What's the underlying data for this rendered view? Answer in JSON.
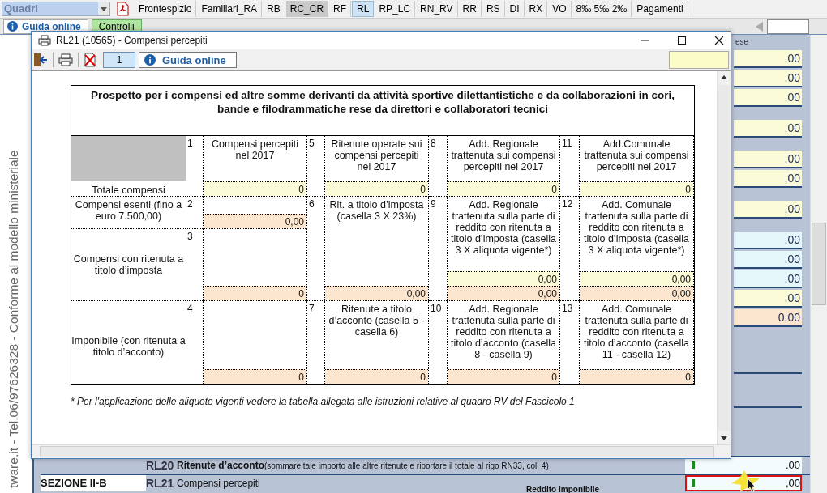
{
  "app": {
    "section_dropdown": {
      "value": "Quadri"
    },
    "tabs": [
      {
        "label": "Frontespizio",
        "selected": false,
        "pressed": false
      },
      {
        "label": "Familiari_RA",
        "selected": false,
        "pressed": false
      },
      {
        "label": "RB",
        "selected": false,
        "pressed": false
      },
      {
        "label": "RC_CR",
        "selected": false,
        "pressed": true
      },
      {
        "label": "RF",
        "selected": false,
        "pressed": false
      },
      {
        "label": "RL",
        "selected": true,
        "pressed": false
      },
      {
        "label": "RP_LC",
        "selected": false,
        "pressed": false
      },
      {
        "label": "RN_RV",
        "selected": false,
        "pressed": false
      },
      {
        "label": "RR",
        "selected": false,
        "pressed": false
      },
      {
        "label": "RS",
        "selected": false,
        "pressed": false
      },
      {
        "label": "DI",
        "selected": false,
        "pressed": false
      },
      {
        "label": "RX",
        "selected": false,
        "pressed": false
      },
      {
        "label": "VO",
        "selected": false,
        "pressed": false
      },
      {
        "label": "8‰ 5‰ 2‰",
        "selected": false,
        "pressed": false
      },
      {
        "label": "Pagamenti",
        "selected": false,
        "pressed": false
      }
    ],
    "toolbar": {
      "help_button": "Guida online",
      "checks_button": "Controlli"
    },
    "side_text": "tware.it - Tel.06/97626328 - Conforme al modello ministeriale",
    "column_header": "ese",
    "field_groups": [
      [
        {
          "value": ",00",
          "kind": "input"
        },
        {
          "value": ",00",
          "kind": "input"
        },
        {
          "value": ",00",
          "kind": "input"
        }
      ],
      [
        {
          "value": ",00",
          "kind": "input"
        }
      ],
      [
        {
          "value": ",00",
          "kind": "input"
        },
        {
          "value": ",00",
          "kind": "input"
        }
      ],
      [
        {
          "value": ",00",
          "kind": "input"
        }
      ],
      [
        {
          "value": ",00",
          "kind": "linked"
        },
        {
          "value": ",00",
          "kind": "linked"
        },
        {
          "value": ",00",
          "kind": "linked"
        },
        {
          "value": ",00",
          "kind": "input"
        },
        {
          "value": "0,00",
          "kind": "calculated"
        }
      ]
    ],
    "rows": [
      {
        "code": "RL20",
        "label": "Ritenute d’acconto",
        "note": "(sommare tale importo alle altre ritenute e riportare il totale al rigo RN33, col. 4)",
        "value": ".00",
        "highlighted": false
      },
      {
        "section": "SEZIONE II-B",
        "code": "RL21",
        "label": "Compensi percepiti",
        "value": ",00",
        "highlighted": true
      }
    ],
    "next_header": "Reddito imponibile"
  },
  "dialog": {
    "title": "RL21 (10565) - Compensi percepiti",
    "page": "1",
    "help_button": "Guida online",
    "table": {
      "title": "Prospetto per i compensi ed altre somme derivanti da attività sportive dilettantistiche e da collaborazioni in cori, bande e filodrammatiche rese da direttori e collaboratori tecnici",
      "row_labels": [
        "Totale compensi",
        "Compensi esenti (fino a euro 7.500,00)",
        "Compensi con ritenuta a titolo d’imposta",
        "Imponibile (con ritenuta a titolo d’acconto)"
      ],
      "columns": [
        {
          "boxes": [
            {
              "number": "1",
              "label": "Compensi percepiti nel 2017",
              "values": [
                {
                  "text": "0",
                  "kind": "input"
                }
              ]
            },
            {
              "number": "2",
              "values": [
                {
                  "text": "0,00",
                  "kind": "calculated"
                }
              ]
            },
            {
              "number": "3",
              "values": [
                {
                  "text": "0",
                  "kind": "calculated"
                }
              ]
            },
            {
              "number": "4",
              "values": [
                {
                  "text": "0",
                  "kind": "calculated"
                }
              ]
            }
          ]
        },
        {
          "boxes": [
            {
              "number": "5",
              "label": "Ritenute operate sui compensi percepiti nel 2017",
              "values": [
                {
                  "text": "0",
                  "kind": "input"
                }
              ]
            },
            {
              "number": "6",
              "label": "Rit. a titolo d’imposta (casella 3 X 23%)",
              "values": [
                {
                  "text": "0,00",
                  "kind": "calculated"
                }
              ]
            },
            {
              "number": "7",
              "label": "Ritenute a titolo d’acconto (casella 5 - casella 6)",
              "values": [
                {
                  "text": "0",
                  "kind": "calculated"
                }
              ]
            }
          ]
        },
        {
          "boxes": [
            {
              "number": "8",
              "label": "Add. Regionale trattenuta sui compensi percepiti nel 2017",
              "values": [
                {
                  "text": "0",
                  "kind": "input"
                }
              ]
            },
            {
              "number": "9",
              "label": "Add. Regionale trattenuta sulla parte di reddito con ritenuta a titolo d’imposta (casella 3 X aliquota vigente*)",
              "values": [
                {
                  "text": "0,00",
                  "kind": "input"
                },
                {
                  "text": "0,00",
                  "kind": "calculated"
                }
              ]
            },
            {
              "number": "10",
              "label": "Add. Regionale trattenuta sulla parte di reddito con ritenuta a titolo d’acconto (casella 8 - casella 9)",
              "values": [
                {
                  "text": "0",
                  "kind": "calculated"
                }
              ]
            }
          ]
        },
        {
          "boxes": [
            {
              "number": "11",
              "label": "Add.Comunale trattenuta sui compensi percepiti nel 2017",
              "values": [
                {
                  "text": "0",
                  "kind": "input"
                }
              ]
            },
            {
              "number": "12",
              "label": "Add. Comunale trattenuta sulla parte di reddito con ritenuta a titolo d’imposta (casella 3 X aliquota vigente*)",
              "values": [
                {
                  "text": "0,00",
                  "kind": "input"
                },
                {
                  "text": "0,00",
                  "kind": "calculated"
                }
              ]
            },
            {
              "number": "13",
              "label": "Add. Comunale trattenuta sulla parte di reddito con ritenuta a titolo d’acconto (casella 11 - casella 12)",
              "values": [
                {
                  "text": "0",
                  "kind": "calculated"
                }
              ]
            }
          ]
        }
      ]
    },
    "footnote": "* Per l'applicazione delle aliquote vigenti vedere la tabella allegata alle istruzioni relative al quadro RV del Fascicolo 1"
  }
}
